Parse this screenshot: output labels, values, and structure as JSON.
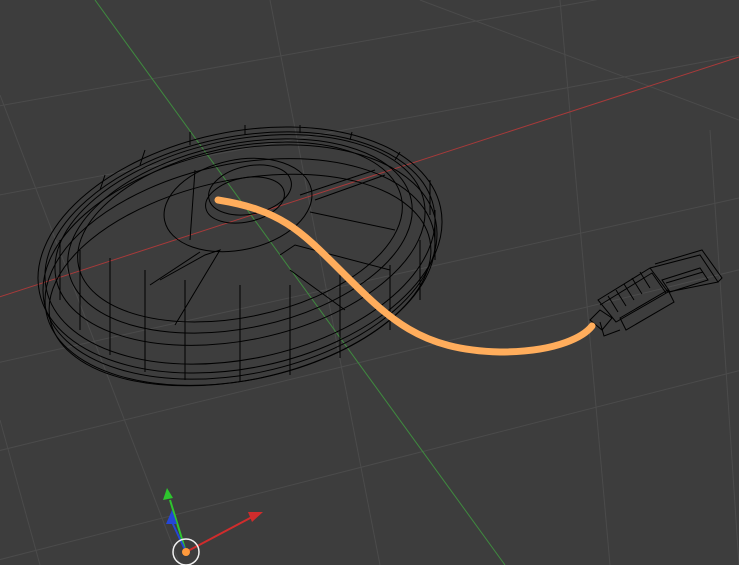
{
  "viewport": {
    "view_type": "3D viewport, wireframe shading",
    "background_color": "#3d3d3d",
    "grid_color": "#4b4b4b",
    "wire_color": "#000000"
  },
  "axes": {
    "x_axis_color": "#a83a3a",
    "y_axis_color": "#3f8a3f"
  },
  "objects": [
    {
      "name": "cable-reel",
      "display": "wireframe",
      "color": "#000000"
    },
    {
      "name": "cable",
      "display": "selected",
      "color": "#ffad5c"
    },
    {
      "name": "usb-connector",
      "display": "wireframe",
      "color": "#000000"
    }
  ],
  "gizmo": {
    "x_color": "#d02c2c",
    "y_color": "#2ec52e",
    "z_color": "#2447d6",
    "cursor_color": "#ff9a3c"
  }
}
